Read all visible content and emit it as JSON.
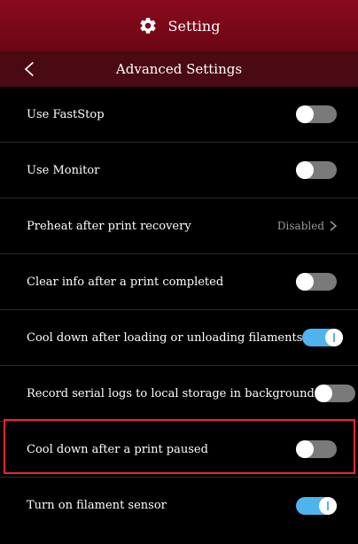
{
  "header": {
    "title": "Setting",
    "icon": "gear-icon"
  },
  "subheader": {
    "title": "Advanced Settings",
    "back_icon": "chevron-left-icon"
  },
  "settings": [
    {
      "label": "Use FastStop",
      "type": "toggle",
      "state": "off"
    },
    {
      "label": "Use Monitor",
      "type": "toggle",
      "state": "off"
    },
    {
      "label": "Preheat after print recovery",
      "type": "value",
      "value": "Disabled"
    },
    {
      "label": "Clear info after a print completed",
      "type": "toggle",
      "state": "off"
    },
    {
      "label": "Cool down after loading or unloading filaments",
      "type": "toggle",
      "state": "on"
    },
    {
      "label": "Record serial logs to local storage in background",
      "type": "toggle",
      "state": "off"
    },
    {
      "label": "Cool down after a print paused",
      "type": "toggle",
      "state": "off",
      "highlighted": true
    },
    {
      "label": "Turn on filament sensor",
      "type": "toggle",
      "state": "on"
    }
  ],
  "colors": {
    "header_bg": "#7a0819",
    "subheader_bg": "#4a0a13",
    "toggle_on": "#4fb3ee",
    "toggle_off": "#7a7a7a",
    "highlight_border": "#e8282d"
  }
}
